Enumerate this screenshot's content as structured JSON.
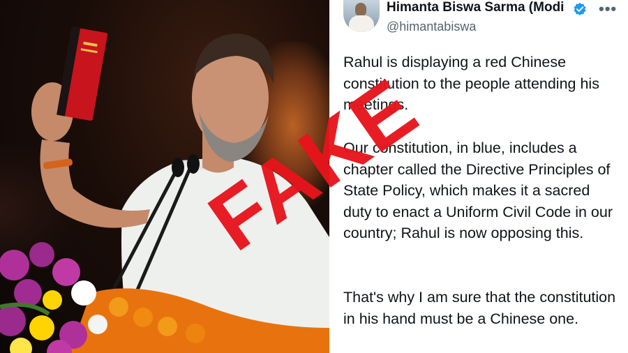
{
  "tweet": {
    "author_name": "Himanta Biswa Sarma (Modi",
    "handle": "@himantabiswa",
    "more_icon": "more-icon",
    "verified_icon": "verified-badge-icon",
    "verified_color": "#1d9bf0",
    "paragraph_1": "Rahul is displaying a red Chinese constitution to the people attending his meetings.",
    "paragraph_2": "Our constitution, in blue, includes a chapter called the Directive Principles of State Policy, which makes it a sacred duty to enact a Uniform Civil Code in our country; Rahul is now opposing this.",
    "paragraph_3": "That's why I am sure that the constitution in his hand must be a Chinese one."
  },
  "stamp": {
    "label": "FAKE",
    "color": "#e8141c"
  },
  "photo": {
    "book_color": "#c8141c",
    "flower_colors": [
      "#b0309a",
      "#ffd400",
      "#f07a10",
      "#ffffff"
    ]
  }
}
